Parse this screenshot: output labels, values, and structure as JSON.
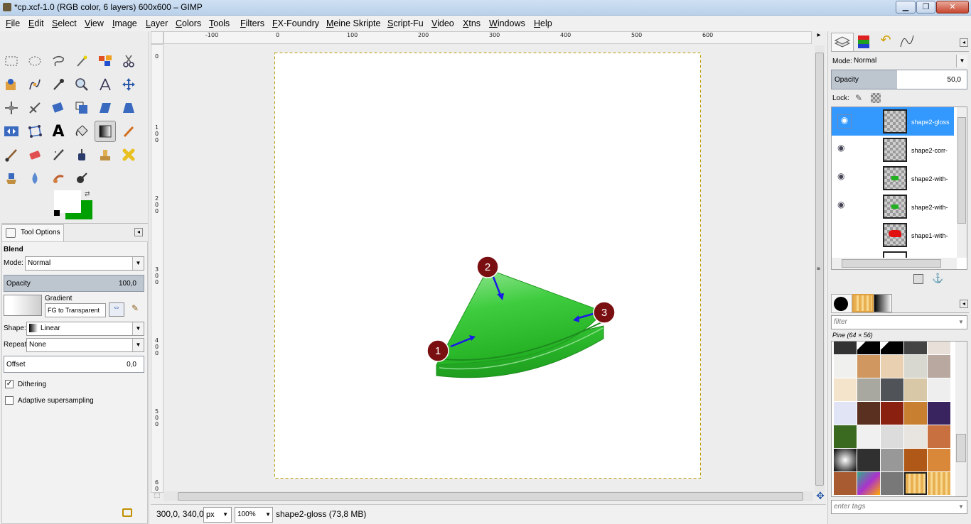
{
  "window": {
    "title": "*cp.xcf-1.0 (RGB color, 6 layers) 600x600 – GIMP"
  },
  "menu": [
    "File",
    "Edit",
    "Select",
    "View",
    "Image",
    "Layer",
    "Colors",
    "Tools",
    "Filters",
    "FX-Foundry",
    "Meine Skripte",
    "Script-Fu",
    "Video",
    "Xtns",
    "Windows",
    "Help"
  ],
  "tool_options": {
    "tab": "Tool Options",
    "tool_name": "Blend",
    "mode_label": "Mode:",
    "mode_value": "Normal",
    "opacity_label": "Opacity",
    "opacity_value": "100,0",
    "gradient_label": "Gradient",
    "gradient_value": "FG to Transparent",
    "shape_label": "Shape:",
    "shape_value": "Linear",
    "repeat_label": "Repeat:",
    "repeat_value": "None",
    "offset_label": "Offset",
    "offset_value": "0,0",
    "dithering_label": "Dithering",
    "dithering_checked": true,
    "adaptive_label": "Adaptive supersampling",
    "adaptive_checked": false
  },
  "ruler": {
    "h_ticks": [
      "-100",
      "0",
      "100",
      "200",
      "300",
      "400",
      "500",
      "600"
    ],
    "v_ticks": [
      "0",
      "1\n0\n0",
      "2\n0\n0",
      "3\n0\n0",
      "4\n0\n0",
      "5\n0\n0",
      "6\n0"
    ]
  },
  "annotations": [
    "1",
    "2",
    "3"
  ],
  "status": {
    "coords": "300,0, 340,0",
    "unit": "px",
    "zoom": "100",
    "zoom_suffix": "%",
    "info": "shape2-gloss (73,8 MB)"
  },
  "layers_panel": {
    "mode_label": "Mode:",
    "mode_value": "Normal",
    "opacity_label": "Opacity",
    "opacity_value": "50,0",
    "lock_label": "Lock:",
    "layers": [
      {
        "name": "shape2-gloss",
        "visible": true,
        "selected": true
      },
      {
        "name": "shape2-corr-",
        "visible": true,
        "selected": false
      },
      {
        "name": "shape2-with-",
        "visible": true,
        "selected": false
      },
      {
        "name": "shape2-with-",
        "visible": true,
        "selected": false
      },
      {
        "name": "shape1-with-",
        "visible": false,
        "selected": false
      }
    ]
  },
  "patterns_panel": {
    "filter_placeholder": "filter",
    "pattern_name": "Pine (64 × 56)",
    "tags_placeholder": "enter tags"
  },
  "colors": {
    "fg": "#ffffff",
    "bg": "#00a000",
    "selection": "#3399ff",
    "shape": "#33c433",
    "marker": "#7a0f12",
    "arrow": "#1a1ae6"
  },
  "window_buttons": {
    "minimize": "▁",
    "maximize": "❐",
    "close": "✕"
  }
}
